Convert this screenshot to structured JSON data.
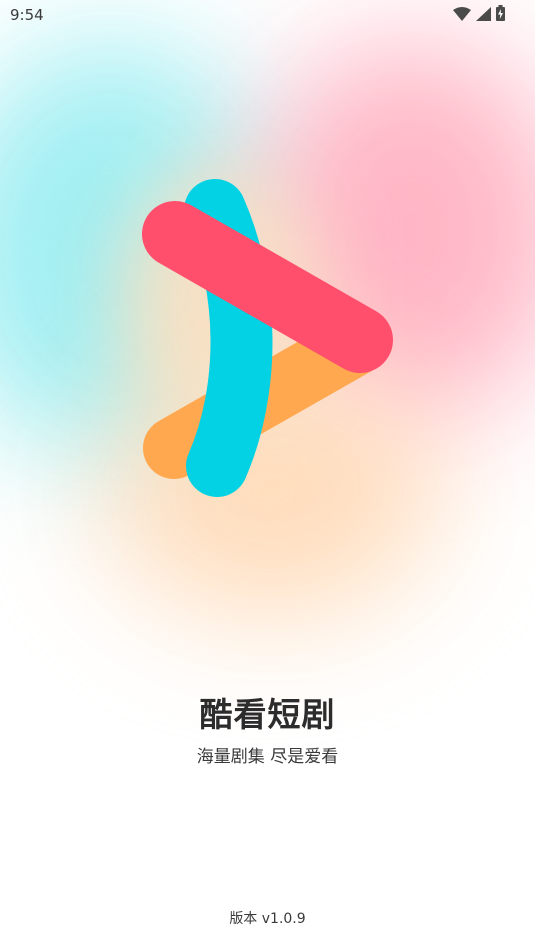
{
  "status_bar": {
    "time": "9:54",
    "icons": [
      "wifi-icon",
      "cellular-signal-icon",
      "battery-charging-icon"
    ]
  },
  "splash": {
    "app_name": "酷看短剧",
    "slogan": "海量剧集 尽是爱看",
    "version": "版本 v1.0.9"
  },
  "colors": {
    "logo_cyan": "#02d2e3",
    "logo_pink": "#ff4f6c",
    "logo_orange": "#ffa84f",
    "bg_cyan": "#9ceef2",
    "bg_pink": "#ffb2c2",
    "bg_orange": "#ffd9b5",
    "text": "#2c2c2c"
  }
}
